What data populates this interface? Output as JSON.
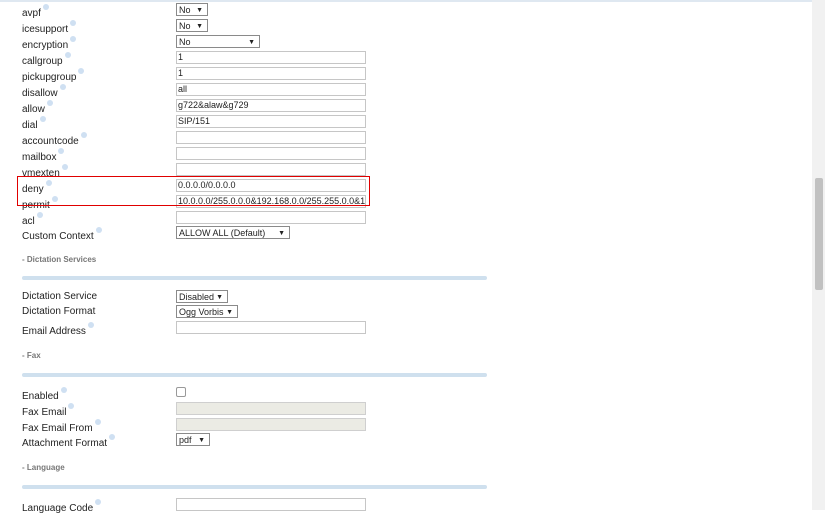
{
  "fields": [
    {
      "label": "avpf",
      "help": true,
      "type": "select",
      "value": "No"
    },
    {
      "label": "icesupport",
      "help": true,
      "type": "select",
      "value": "No"
    },
    {
      "label": "encryption",
      "help": true,
      "type": "select",
      "value": "No"
    },
    {
      "label": "callgroup",
      "help": true,
      "type": "text",
      "value": "1"
    },
    {
      "label": "pickupgroup",
      "help": true,
      "type": "text",
      "value": "1"
    },
    {
      "label": "disallow",
      "help": true,
      "type": "text",
      "value": "all"
    },
    {
      "label": "allow",
      "help": true,
      "type": "text",
      "value": "g722&alaw&g729"
    },
    {
      "label": "dial",
      "help": true,
      "type": "text",
      "value": "SIP/151"
    },
    {
      "label": "accountcode",
      "help": true,
      "type": "text",
      "value": ""
    },
    {
      "label": "mailbox",
      "help": true,
      "type": "text",
      "value": ""
    },
    {
      "label": "vmexten",
      "help": true,
      "type": "text",
      "value": ""
    },
    {
      "label": "deny",
      "help": true,
      "type": "text",
      "value": "0.0.0.0/0.0.0.0"
    },
    {
      "label": "permit",
      "help": true,
      "type": "text",
      "value": "10.0.0.0/255.0.0.0&192.168.0.0/255.255.0.0&1"
    },
    {
      "label": "acl",
      "help": true,
      "type": "text",
      "value": ""
    },
    {
      "label": "Custom Context",
      "help": true,
      "type": "select",
      "value": "ALLOW ALL (Default)"
    }
  ],
  "sections": {
    "dictation": {
      "title": "- Dictation Services",
      "fields": [
        {
          "label": "Dictation Service",
          "type": "select",
          "value": "Disabled"
        },
        {
          "label": "Dictation Format",
          "type": "select",
          "value": "Ogg Vorbis"
        },
        {
          "label": "Email Address",
          "help": true,
          "type": "text",
          "value": ""
        }
      ]
    },
    "fax": {
      "title": "- Fax",
      "fields": [
        {
          "label": "Enabled",
          "help": true,
          "type": "checkbox",
          "value": ""
        },
        {
          "label": "Fax Email",
          "help": true,
          "type": "text",
          "value": ""
        },
        {
          "label": "Fax Email From",
          "help": true,
          "type": "text",
          "value": ""
        },
        {
          "label": "Attachment Format",
          "help": true,
          "type": "select",
          "value": "pdf"
        }
      ]
    },
    "language": {
      "title": "- Language",
      "fields": [
        {
          "label": "Language Code",
          "help": true,
          "type": "text",
          "value": ""
        }
      ]
    }
  }
}
